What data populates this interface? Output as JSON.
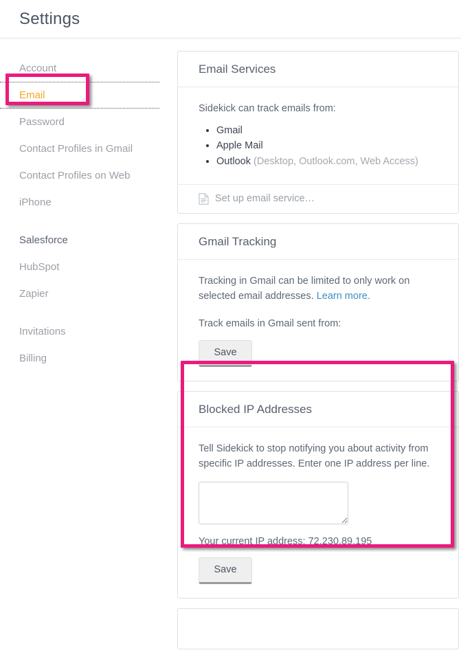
{
  "header": {
    "title": "Settings"
  },
  "sidebar": {
    "items": [
      {
        "label": "Account",
        "state": "normal"
      },
      {
        "label": "Email",
        "state": "active"
      },
      {
        "label": "Password",
        "state": "normal"
      },
      {
        "label": "Contact Profiles in Gmail",
        "state": "normal"
      },
      {
        "label": "Contact Profiles on Web",
        "state": "normal"
      },
      {
        "label": "iPhone",
        "state": "normal"
      },
      {
        "label": "Salesforce",
        "state": "strong"
      },
      {
        "label": "HubSpot",
        "state": "normal"
      },
      {
        "label": "Zapier",
        "state": "normal"
      },
      {
        "label": "Invitations",
        "state": "normal"
      },
      {
        "label": "Billing",
        "state": "normal"
      }
    ]
  },
  "cards": {
    "email_services": {
      "title": "Email Services",
      "intro": "Sidekick can track emails from:",
      "services": [
        {
          "name": "Gmail",
          "note": ""
        },
        {
          "name": "Apple Mail",
          "note": ""
        },
        {
          "name": "Outlook",
          "note": " (Desktop, Outlook.com, Web Access)"
        }
      ],
      "footer_label": "Set up email service…",
      "footer_icon": "document-icon"
    },
    "gmail_tracking": {
      "title": "Gmail Tracking",
      "description": "Tracking in Gmail can be limited to only work on selected email addresses.",
      "learn_more": "Learn more.",
      "track_label": "Track emails in Gmail sent from:",
      "save_label": "Save"
    },
    "blocked_ip": {
      "title": "Blocked IP Addresses",
      "description": "Tell Sidekick to stop notifying you about activity from specific IP addresses. Enter one IP address per line.",
      "textarea_value": "",
      "textarea_placeholder": "",
      "current_ip_label": "Your current IP address: 72.230.89.195",
      "save_label": "Save"
    }
  },
  "colors": {
    "accent_active": "#f5a623",
    "link": "#3d8fc4",
    "annotation": "#ec1a7d",
    "text_muted": "#9aa0a8"
  }
}
